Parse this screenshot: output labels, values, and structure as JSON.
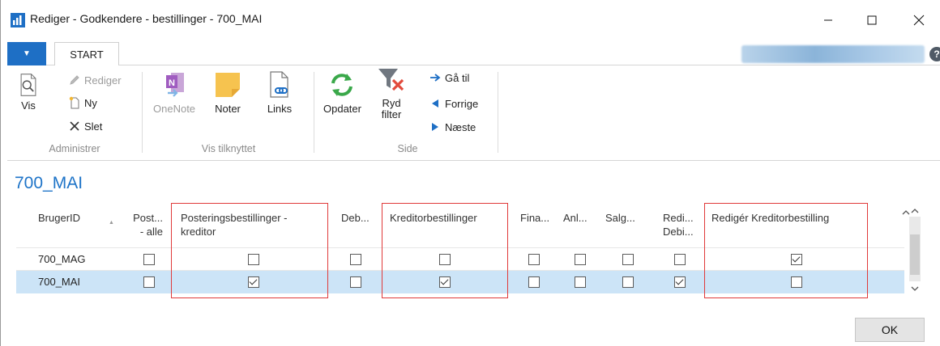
{
  "window": {
    "title": "Rediger - Godkendere - bestillinger - 700_MAI",
    "min_label": "—",
    "max_label": "☐",
    "close_label": "✕"
  },
  "ribbon": {
    "file_tab_glyph": "▼",
    "start_tab": "START",
    "help_glyph": "?",
    "groups": {
      "administrer": "Administrer",
      "vis_tilknyttet": "Vis tilknyttet",
      "side": "Side"
    },
    "buttons": {
      "vis": "Vis",
      "rediger": "Rediger",
      "ny": "Ny",
      "slet": "Slet",
      "onenote": "OneNote",
      "noter": "Noter",
      "links": "Links",
      "opdater": "Opdater",
      "ryd_filter_line1": "Ryd",
      "ryd_filter_line2": "filter",
      "ga_til": "Gå til",
      "forrige": "Forrige",
      "naeste": "Næste"
    }
  },
  "page": {
    "heading": "700_MAI"
  },
  "grid": {
    "columns": {
      "brugerid": "BrugerID",
      "sort_glyph": "▲",
      "post_alle_1": "Post...",
      "post_alle_2": "- alle",
      "posteringsbestillinger_1": "Posteringsbestillinger -",
      "posteringsbestillinger_2": "kreditor",
      "deb": "Deb...",
      "kreditorbestillinger": "Kreditorbestillinger",
      "fina": "Fina...",
      "anl": "Anl...",
      "salg": "Salg...",
      "redi_1": "Redi...",
      "redi_2": "Debi...",
      "rediger_kreditorbestilling": "Redigér Kreditorbestilling"
    },
    "rows": [
      {
        "brugerid": "700_MAG",
        "post_alle": false,
        "posteringsbestillinger_kreditor": false,
        "deb": false,
        "kreditorbestillinger": false,
        "fina": false,
        "anl": false,
        "salg": false,
        "redi_debi": false,
        "rediger_kreditorbestilling": true,
        "selected": false
      },
      {
        "brugerid": "700_MAI",
        "post_alle": false,
        "posteringsbestillinger_kreditor": true,
        "deb": false,
        "kreditorbestillinger": true,
        "fina": false,
        "anl": false,
        "salg": false,
        "redi_debi": true,
        "rediger_kreditorbestilling": false,
        "selected": true
      }
    ]
  },
  "scrollbar": {
    "up_glyph": "^",
    "down_glyph": "⌄"
  },
  "footer": {
    "ok": "OK"
  },
  "colors": {
    "accent": "#1e74c8",
    "file_tab": "#1e6fc5",
    "selected_row": "#cce4f7",
    "highlight": "#e03a3a"
  }
}
